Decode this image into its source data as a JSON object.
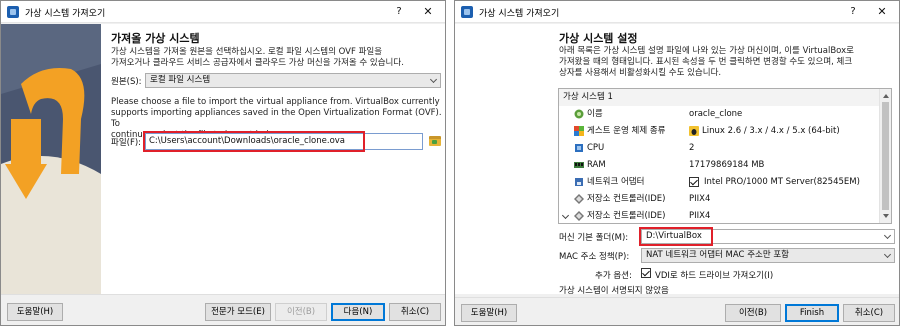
{
  "left": {
    "window_title": "가상 시스템 가져오기",
    "title_help": "?",
    "title_close": "✕",
    "heading": "가져올 가상 시스템",
    "intro_line1": "가상 시스템을 가져올 원본을 선택하십시오. 로컬 파일 시스템의 OVF 파일을",
    "intro_line2": "가져오거나 클라우드 서비스 공급자에서 클라우드 가상 머신을 가져올 수 있습니다.",
    "source_label": "원본(S):",
    "source_value": "로컬 파일 시스템",
    "desc_line1": "Please choose a file to import the virtual appliance from. VirtualBox currently",
    "desc_line2": "supports importing appliances saved in the Open Virtualization Format (OVF). To",
    "desc_line3": "continue, select the file to import below.",
    "file_label": "파일(F):",
    "file_value": "C:\\Users\\account\\Downloads\\oracle_clone.ova",
    "help_btn": "도움말(H)",
    "expert_btn": "전문가 모드(E)",
    "back_btn": "이전(B)",
    "next_btn": "다음(N)",
    "cancel_btn": "취소(C)"
  },
  "right": {
    "window_title": "가상 시스템 가져오기",
    "title_help": "?",
    "title_close": "✕",
    "heading": "가상 시스템 설정",
    "intro_line1": "아래 목록은 가상 시스템 설명 파일에 나와 있는 가상 머신이며, 이를 VirtualBox로",
    "intro_line2": "가져왔을 때의 형태입니다. 표시된 속성을 두 번 클릭하면 변경할 수도 있으며, 체크",
    "intro_line3": "상자를 사용해서 비활성화시킬 수도 있습니다.",
    "group_label": "가상 시스템 1",
    "rows": [
      {
        "name": "이름",
        "value": "oracle_clone",
        "icon": "name-icon"
      },
      {
        "name": "게스트 운영 체제 종류",
        "value": "Linux 2.6 / 3.x / 4.x / 5.x (64-bit)",
        "icon": "os-type-icon"
      },
      {
        "name": "CPU",
        "value": "2",
        "icon": "cpu-icon"
      },
      {
        "name": "RAM",
        "value": "17179869184 MB",
        "icon": "ram-icon"
      },
      {
        "name": "네트워크 어댑터",
        "value": "Intel PRO/1000 MT Server(82545EM)",
        "icon": "network-icon"
      },
      {
        "name": "저장소 컨트롤러(IDE)",
        "value": "PIIX4",
        "icon": "storage-controller-icon"
      },
      {
        "name": "저장소 컨트롤러(IDE)",
        "value": "PIIX4",
        "icon": "storage-controller-icon"
      }
    ],
    "base_folder_label": "머신 기본 폴더(M):",
    "base_folder_value": "D:\\VirtualBox",
    "mac_label": "MAC 주소 정책(P):",
    "mac_value": "NAT 네트워크 어댑터 MAC 주소만 포함",
    "extra_label": "추가 옵션:",
    "extra_option": "VDI로 하드 드라이브 가져오기(I)",
    "signed_status": "가상 시스템이 서명되지 않았음",
    "help_btn": "도움말(H)",
    "back_btn": "이전(B)",
    "finish_btn": "Finish",
    "cancel_btn": "취소(C)"
  },
  "colors": {
    "highlight_border": "#e0202a",
    "art_background": "#4a5670",
    "art_arrow": "#f3a124",
    "focus_blue": "#0078d7"
  }
}
